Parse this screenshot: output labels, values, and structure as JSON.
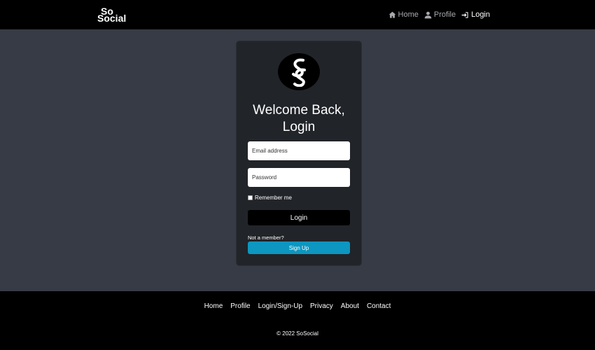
{
  "brand": {
    "line1": "So",
    "line2": "Social",
    "letter": "S"
  },
  "nav": {
    "items": [
      {
        "label": "Home",
        "icon": "home-icon",
        "active": false
      },
      {
        "label": "Profile",
        "icon": "user-icon",
        "active": false
      },
      {
        "label": "Login",
        "icon": "login-icon",
        "active": true
      }
    ]
  },
  "card": {
    "title_line1": "Welcome Back,",
    "title_line2": "Login",
    "email_placeholder": "Email address",
    "password_placeholder": "Password",
    "remember_label": "Remember me",
    "login_button": "Login",
    "not_member": "Not a member?",
    "signup_button": "Sign Up"
  },
  "footer": {
    "links": [
      "Home",
      "Profile",
      "Login/Sign-Up",
      "Privacy",
      "About",
      "Contact"
    ],
    "copyright": "© 2022 SoSocial"
  },
  "colors": {
    "page_bg": "#373b45",
    "nav_bg": "#000000",
    "card_bg": "#212429",
    "signup_accent": "#0d96bf"
  }
}
